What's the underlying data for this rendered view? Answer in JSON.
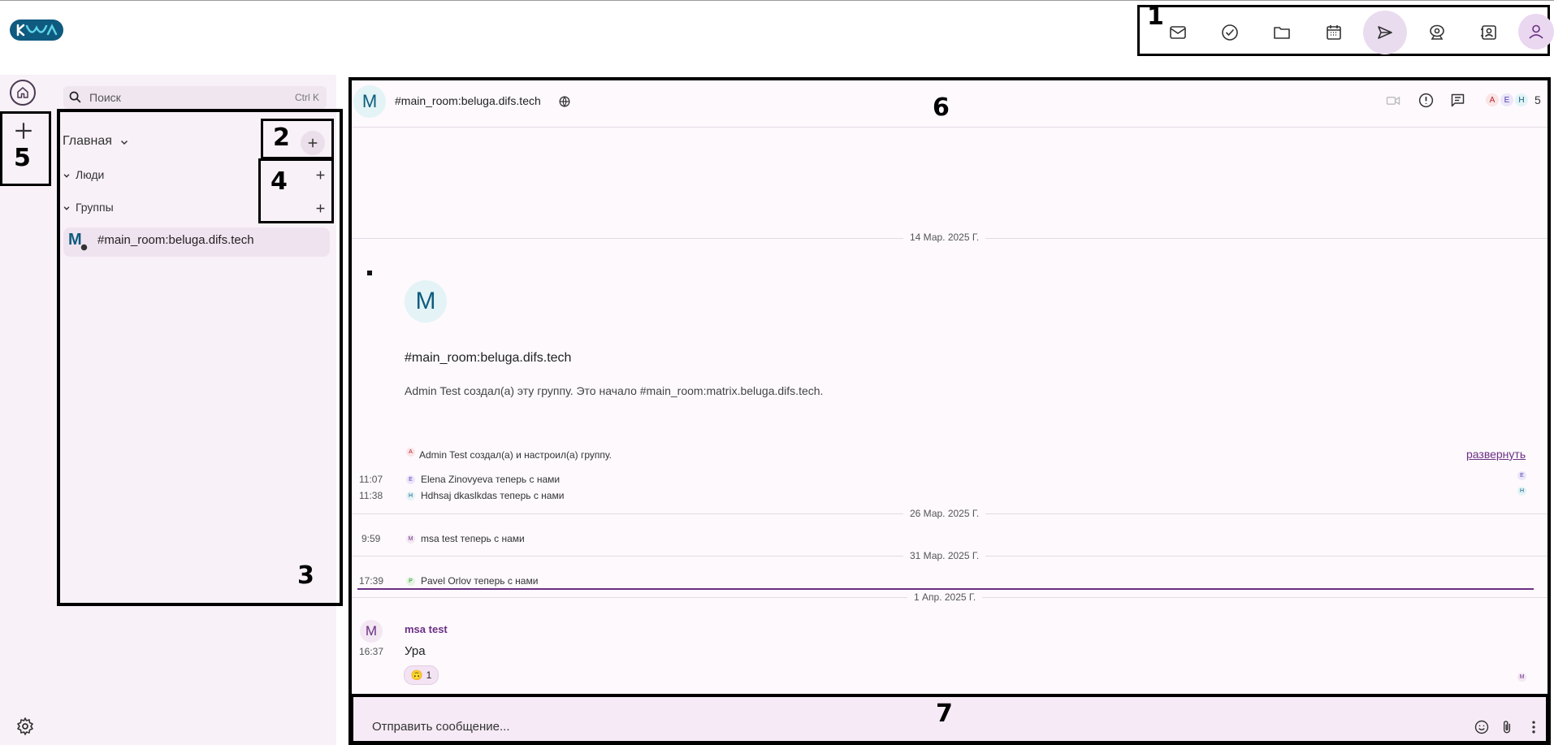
{
  "app": {
    "logo_text": "Logo"
  },
  "annotations": {
    "a1": "1",
    "a2": "2",
    "a3": "3",
    "a4": "4",
    "a5": "5",
    "a6": "6",
    "a7": "7"
  },
  "toolbar": {
    "items": [
      {
        "icon": "mail-icon"
      },
      {
        "icon": "tasks-icon"
      },
      {
        "icon": "folder-icon"
      },
      {
        "icon": "calendar-icon"
      },
      {
        "icon": "send-icon",
        "active": true
      },
      {
        "icon": "webcam-icon"
      },
      {
        "icon": "contacts-icon"
      },
      {
        "icon": "user-avatar-icon"
      }
    ]
  },
  "search": {
    "placeholder": "Поиск",
    "shortcut": "Ctrl K"
  },
  "sidebar": {
    "home_section": "Главная",
    "people_label": "Люди",
    "groups_label": "Группы",
    "room": {
      "avatar_letter": "M",
      "name": "#main_room:beluga.difs.tech"
    }
  },
  "room_header": {
    "avatar_letter": "M",
    "title": "#main_room:beluga.difs.tech",
    "member_initials": [
      "A",
      "E",
      "H"
    ],
    "member_count": "5"
  },
  "timeline": {
    "date1": "14 Мар. 2025 Г.",
    "intro_avatar": "M",
    "intro_title": "#main_room:beluga.difs.tech",
    "intro_text": "Admin Test создал(а) эту группу. Это начало #main_room:matrix.beluga.difs.tech.",
    "created_event": {
      "initial": "A",
      "text": "Admin Test создал(а) и настроил(а) группу."
    },
    "expand_link": "развернуть",
    "events": [
      {
        "time": "11:07",
        "initial": "E",
        "text": "Elena Zinovyeva теперь с нами"
      },
      {
        "time": "11:38",
        "initial": "H",
        "text": "Hdhsaj dkaslkdas теперь с нами"
      }
    ],
    "date2": "26 Мар. 2025 Г.",
    "event3": {
      "time": "9:59",
      "initial": "M",
      "text": "msa test теперь с нами"
    },
    "date3": "31 Мар. 2025 Г.",
    "event4": {
      "time": "17:39",
      "initial": "P",
      "text": "Pavel Orlov теперь с нами"
    },
    "date4": "1 Апр. 2025 Г.",
    "message": {
      "avatar": "M",
      "sender": "msa test",
      "time": "16:37",
      "body": "Ура",
      "reaction_emoji": "🙃",
      "reaction_count": "1",
      "read_marker": "M"
    }
  },
  "composer": {
    "placeholder": "Отправить сообщение..."
  }
}
